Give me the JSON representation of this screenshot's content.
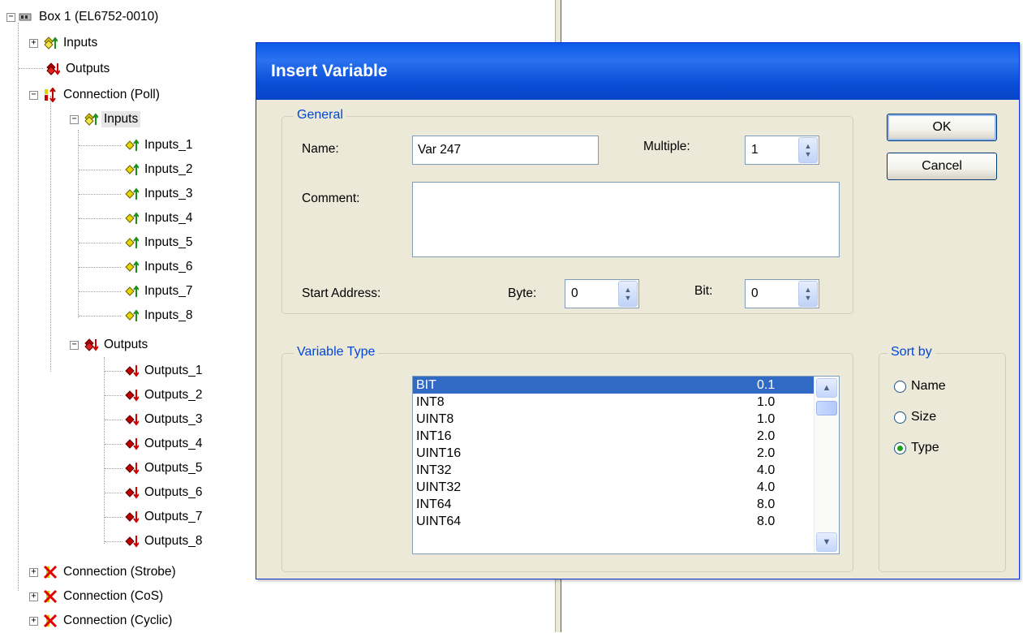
{
  "tree": {
    "box_label": "Box 1 (EL6752-0010)",
    "inputs_label": "Inputs",
    "outputs_label": "Outputs",
    "connection_poll_label": "Connection (Poll)",
    "poll_inputs_label": "Inputs",
    "poll_input_items": [
      "Inputs_1",
      "Inputs_2",
      "Inputs_3",
      "Inputs_4",
      "Inputs_5",
      "Inputs_6",
      "Inputs_7",
      "Inputs_8"
    ],
    "poll_outputs_label": "Outputs",
    "poll_output_items": [
      "Outputs_1",
      "Outputs_2",
      "Outputs_3",
      "Outputs_4",
      "Outputs_5",
      "Outputs_6",
      "Outputs_7",
      "Outputs_8"
    ],
    "connection_strobe_label": "Connection (Strobe)",
    "connection_cos_label": "Connection (CoS)",
    "connection_cyclic_label": "Connection (Cyclic)"
  },
  "dialog": {
    "title": "Insert Variable",
    "general": {
      "title": "General",
      "name_label": "Name:",
      "name_value": "Var 247",
      "multiple_label": "Multiple:",
      "multiple_value": "1",
      "comment_label": "Comment:",
      "comment_value": "",
      "start_address_label": "Start Address:",
      "byte_label": "Byte:",
      "byte_value": "0",
      "bit_label": "Bit:",
      "bit_value": "0"
    },
    "ok_label": "OK",
    "cancel_label": "Cancel",
    "variable_type": {
      "title": "Variable Type",
      "items": [
        {
          "name": "BIT",
          "size": "0.1",
          "selected": true
        },
        {
          "name": "INT8",
          "size": "1.0"
        },
        {
          "name": "UINT8",
          "size": "1.0"
        },
        {
          "name": "INT16",
          "size": "2.0"
        },
        {
          "name": "UINT16",
          "size": "2.0"
        },
        {
          "name": "INT32",
          "size": "4.0"
        },
        {
          "name": "UINT32",
          "size": "4.0"
        },
        {
          "name": "INT64",
          "size": "8.0"
        },
        {
          "name": "UINT64",
          "size": "8.0"
        }
      ]
    },
    "sort_by": {
      "title": "Sort by",
      "options": [
        {
          "label": "Name",
          "checked": false
        },
        {
          "label": "Size",
          "checked": false
        },
        {
          "label": "Type",
          "checked": true
        }
      ]
    }
  }
}
